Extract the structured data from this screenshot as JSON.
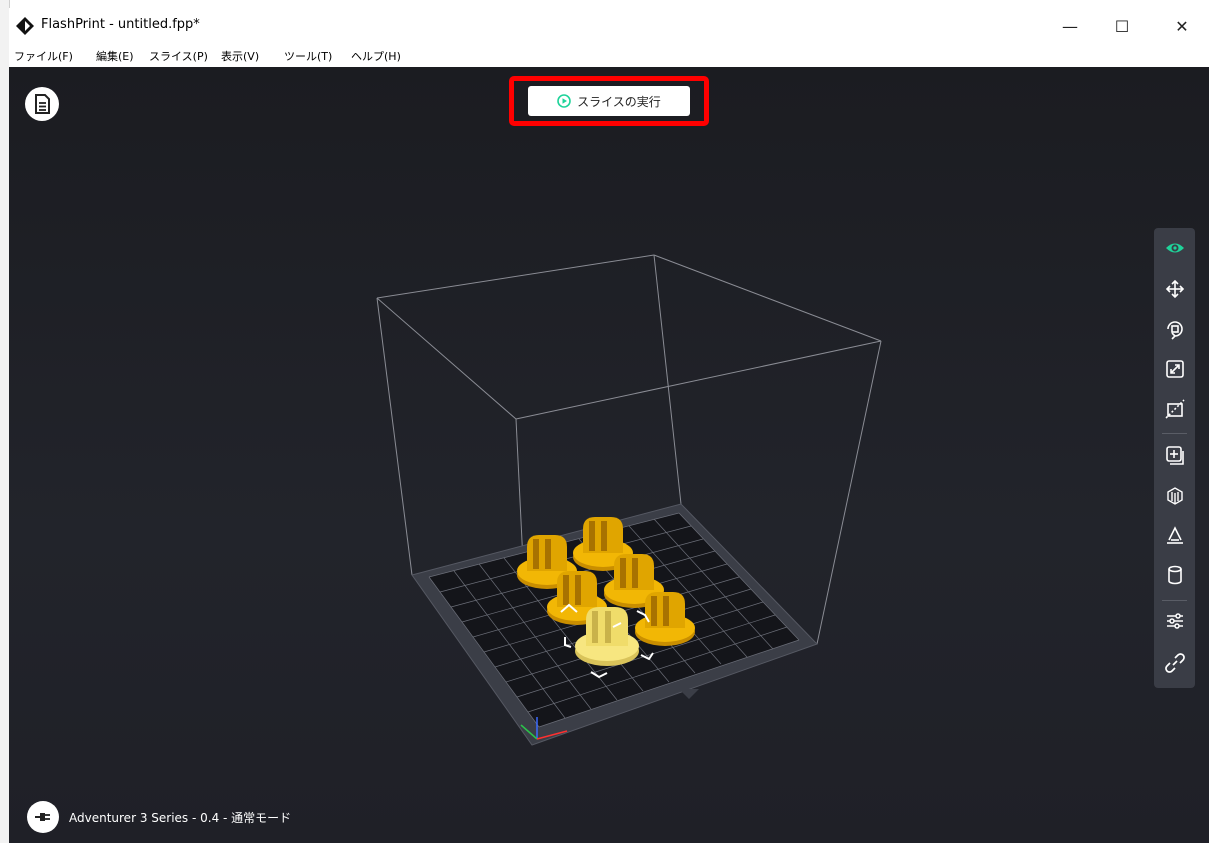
{
  "window": {
    "title": "FlashPrint - untitled.fpp*",
    "controls": {
      "minimize": "—",
      "maximize": "☐",
      "close": "✕"
    }
  },
  "menu": {
    "items": [
      "ファイル(F)",
      "編集(E)",
      "スライス(P)",
      "表示(V)",
      "ツール(T)",
      "ヘルプ(H)"
    ]
  },
  "slice_button": {
    "label": "スライスの実行",
    "icon": "play-circle-icon",
    "highlighted": true
  },
  "toolbar": {
    "tools": [
      {
        "name": "view-icon",
        "active": true
      },
      {
        "name": "move-icon"
      },
      {
        "name": "rotate-icon"
      },
      {
        "name": "scale-icon"
      },
      {
        "name": "cut-icon"
      },
      {
        "name": "add-model-icon"
      },
      {
        "name": "supports-icon"
      },
      {
        "name": "lay-flat-icon"
      },
      {
        "name": "cylinder-icon"
      },
      {
        "name": "settings-sliders-icon"
      },
      {
        "name": "link-icon"
      }
    ]
  },
  "status": {
    "printer_text": "Adventurer 3 Series - 0.4 - 通常モード"
  },
  "colors": {
    "accent": "#1fd39a",
    "model": "#f2b705",
    "model_selected": "#f5e27a",
    "highlight": "#ff0000",
    "viewport_bg": "#1d1e24"
  }
}
